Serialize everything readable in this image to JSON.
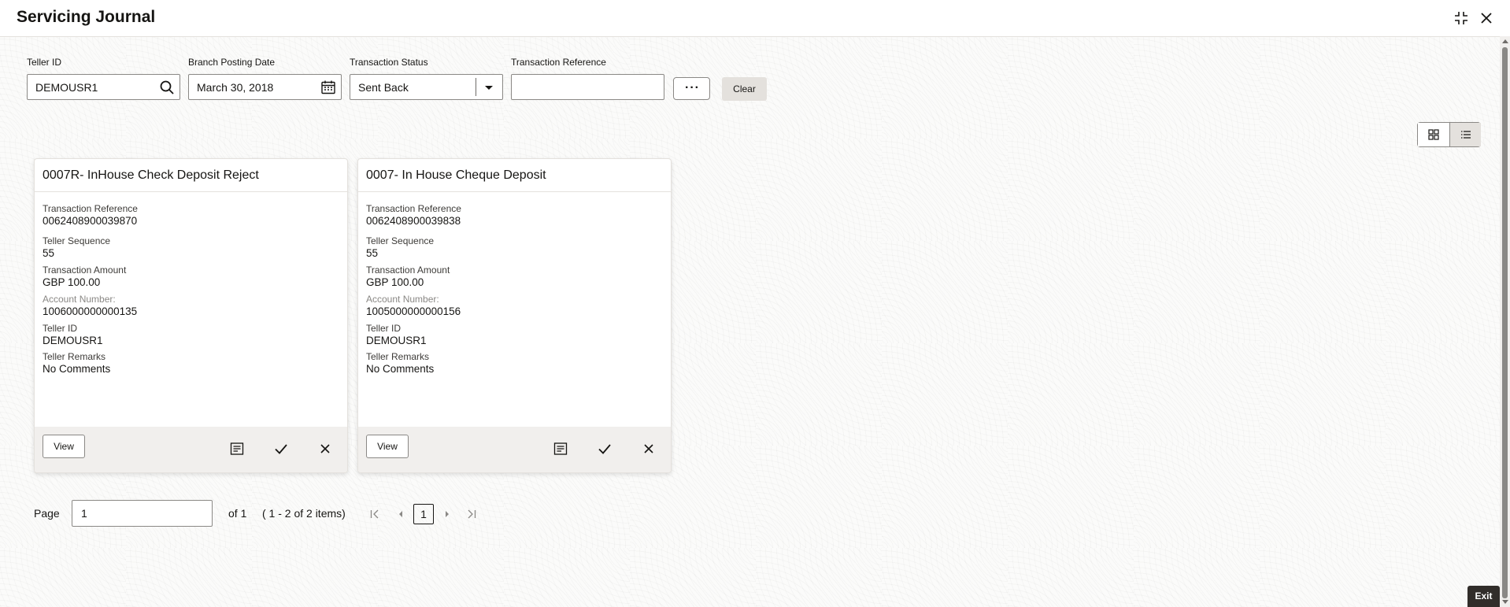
{
  "header": {
    "title": "Servicing Journal"
  },
  "filters": {
    "teller_id": {
      "label": "Teller ID",
      "value": "DEMOUSR1"
    },
    "branch_posting_date": {
      "label": "Branch Posting Date",
      "value": "March 30, 2018"
    },
    "transaction_status": {
      "label": "Transaction Status",
      "value": "Sent Back"
    },
    "transaction_reference": {
      "label": "Transaction Reference",
      "value": ""
    },
    "more_label": "···",
    "clear_label": "Clear"
  },
  "cards": [
    {
      "title": "0007R- InHouse Check Deposit Reject",
      "fields": [
        {
          "label": "Transaction Reference",
          "value": "0062408900039870"
        },
        {
          "label": "Teller Sequence",
          "value": "55"
        },
        {
          "label": "Transaction Amount",
          "value": "GBP 100.00"
        },
        {
          "label": "Account Number:",
          "value": "1006000000000135"
        },
        {
          "label": "Teller ID",
          "value": "DEMOUSR1"
        },
        {
          "label": "Teller Remarks",
          "value": "No Comments"
        }
      ],
      "view_label": "View"
    },
    {
      "title": "0007- In House Cheque Deposit",
      "fields": [
        {
          "label": "Transaction Reference",
          "value": "0062408900039838"
        },
        {
          "label": "Teller Sequence",
          "value": "55"
        },
        {
          "label": "Transaction Amount",
          "value": "GBP 100.00"
        },
        {
          "label": "Account Number:",
          "value": "1005000000000156"
        },
        {
          "label": "Teller ID",
          "value": "DEMOUSR1"
        },
        {
          "label": "Teller Remarks",
          "value": "No Comments"
        }
      ],
      "view_label": "View"
    }
  ],
  "pagination": {
    "page_label": "Page",
    "page_value": "1",
    "of_label": "of 1",
    "items_label": "( 1 - 2 of 2 items)",
    "current_page": "1"
  },
  "footer": {
    "exit_label": "Exit"
  },
  "icons": [
    "collapse-icon",
    "close-icon",
    "search-icon",
    "calendar-icon",
    "chevron-down-icon",
    "grid-view-icon",
    "list-view-icon",
    "notes-icon",
    "check-icon",
    "reject-icon",
    "first-page-icon",
    "prev-page-icon",
    "next-page-icon",
    "last-page-icon"
  ]
}
